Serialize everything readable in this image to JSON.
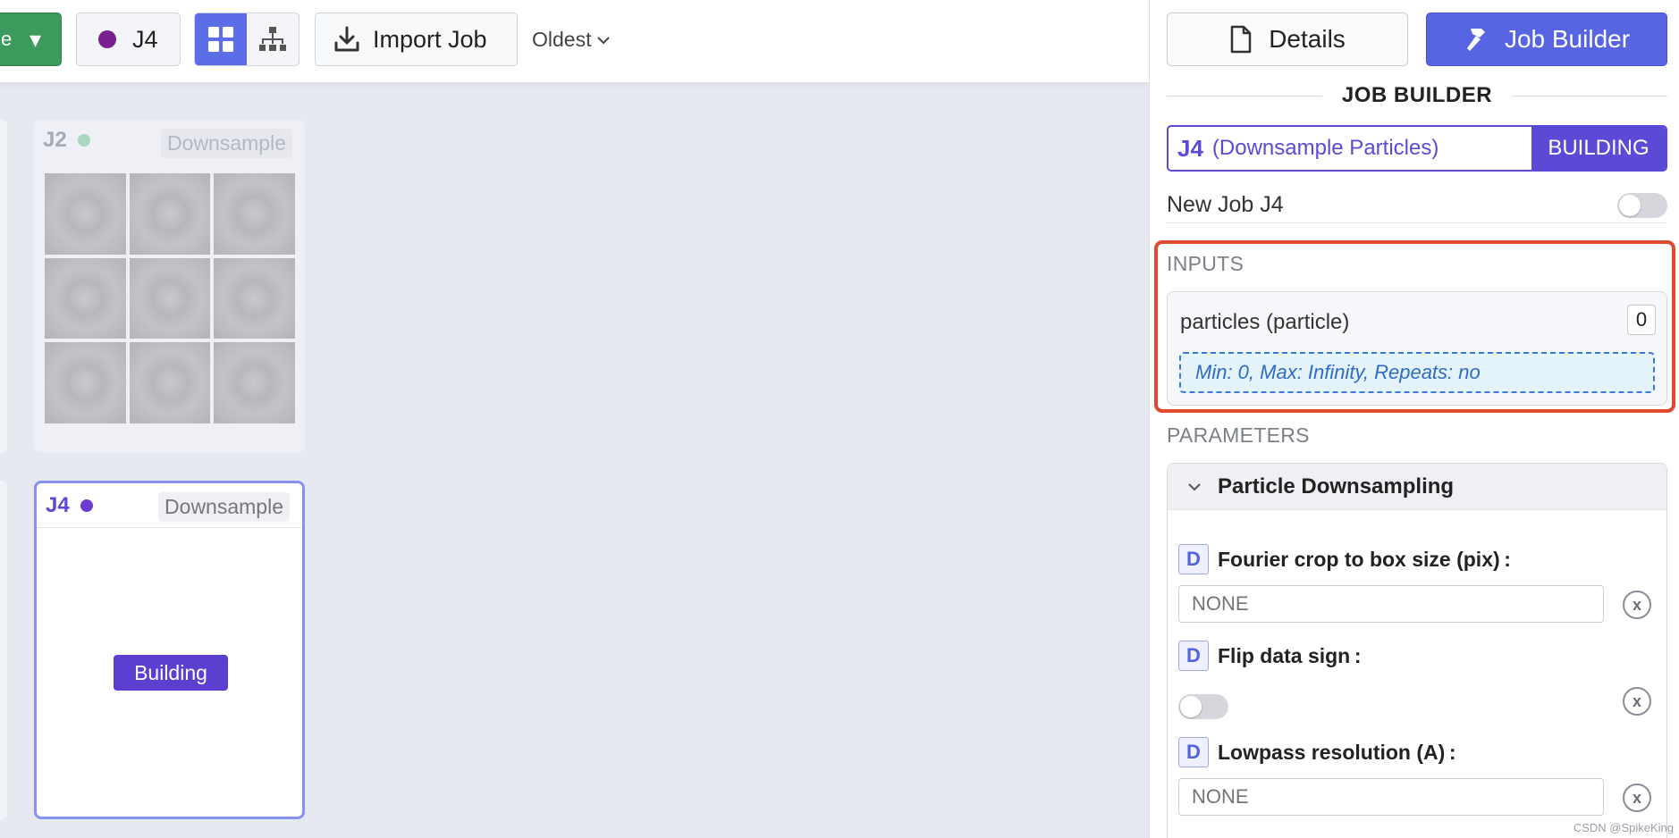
{
  "toolbar": {
    "job_label": "J4",
    "import_label": "Import Job",
    "sort_label": "Oldest"
  },
  "cards": {
    "j2": {
      "id": "J2",
      "type": "Downsample"
    },
    "j4": {
      "id": "J4",
      "type": "Downsample",
      "status": "Building"
    }
  },
  "panel": {
    "details_label": "Details",
    "builder_label": "Job Builder",
    "section_title": "JOB BUILDER",
    "job_id": "J4",
    "job_name": "(Downsample Particles)",
    "job_status": "BUILDING",
    "new_job_label": "New Job J4",
    "inputs_label": "INPUTS",
    "input": {
      "title": "particles (particle)",
      "count": "0",
      "rules": "Min: 0, Max: Infinity, Repeats: no"
    },
    "parameters_label": "PARAMETERS",
    "param_group": "Particle Downsampling",
    "params": [
      {
        "badge": "D",
        "label": "Fourier crop to box size (pix) :",
        "placeholder": "NONE",
        "clear": "x"
      },
      {
        "badge": "D",
        "label": "Flip data sign :",
        "clear": "x"
      },
      {
        "badge": "D",
        "label": "Lowpass resolution (A) :",
        "placeholder": "NONE",
        "clear": "x"
      }
    ]
  },
  "colors": {
    "accent": "#5765e3",
    "building": "#5d3fcf",
    "highlight": "#e04a2f",
    "queue_green": "#3c9a5c"
  },
  "watermark": "CSDN @SpikeKing"
}
